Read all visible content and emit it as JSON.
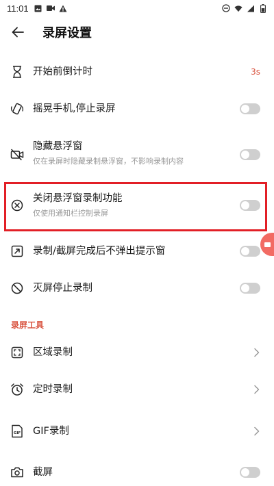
{
  "status_bar": {
    "time": "11:01"
  },
  "header": {
    "title": "录屏设置"
  },
  "settings": [
    {
      "id": "countdown",
      "title": "开始前倒计时",
      "value": "3s"
    },
    {
      "id": "shake",
      "title": "摇晃手机,停止录屏",
      "toggle": false
    },
    {
      "id": "hide-float",
      "title": "隐藏悬浮窗",
      "subtitle": "仅在录屏时隐藏录制悬浮窗，不影响录制内容",
      "toggle": false
    },
    {
      "id": "close-float",
      "title": "关闭悬浮窗录制功能",
      "subtitle": "仅使用通知栏控制录屏",
      "toggle": false
    },
    {
      "id": "no-popup",
      "title": "录制/截屏完成后不弹出提示窗",
      "toggle": false
    },
    {
      "id": "screen-off",
      "title": "灭屏停止录制",
      "toggle": false
    }
  ],
  "tools_section": {
    "label": "录屏工具"
  },
  "tools": [
    {
      "id": "area",
      "title": "区域录制"
    },
    {
      "id": "timed",
      "title": "定时录制"
    },
    {
      "id": "gif",
      "title": "GIF录制",
      "icon_text": "GIF"
    },
    {
      "id": "screenshot",
      "title": "截屏",
      "toggle": false
    }
  ],
  "colors": {
    "accent": "#d9533f",
    "highlight": "#e21f26",
    "toggle_off": "#cfcfcf"
  }
}
